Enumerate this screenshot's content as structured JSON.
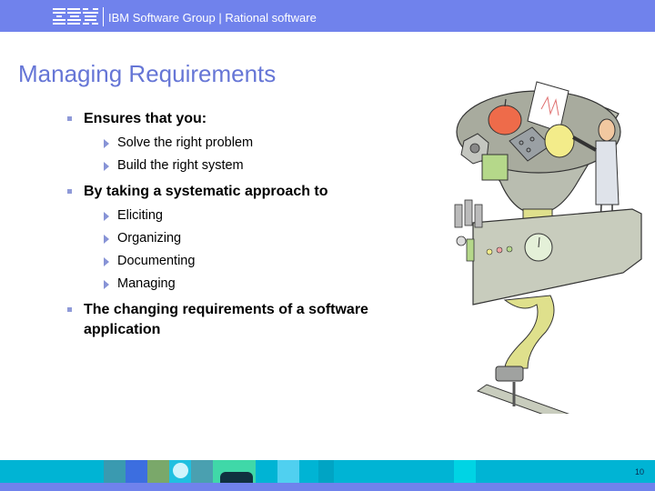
{
  "header": {
    "logo_text": "IBM",
    "title": "IBM Software Group | Rational software"
  },
  "slide": {
    "title": "Managing Requirements",
    "bullets": [
      {
        "text": "Ensures that you:",
        "sub": [
          "Solve the right problem",
          "Build the right system"
        ]
      },
      {
        "text": "By taking a systematic approach to",
        "sub": [
          "Eliciting",
          "Organizing",
          "Documenting",
          "Managing"
        ]
      },
      {
        "text_line1": " The changing requirements of a software",
        "text_line2": "application"
      }
    ]
  },
  "illustration": {
    "description": "Cartoon of a scientist feeding an apple, chart, circuit board, light bulb and gears into a funnel machine that outputs onto a conveyor belt"
  },
  "footer": {
    "page_number": "10"
  },
  "colors": {
    "header_bg": "#7082ec",
    "title": "#6676d6",
    "bullet": "#8f9ad8",
    "footer_band": "#00b4d4"
  }
}
